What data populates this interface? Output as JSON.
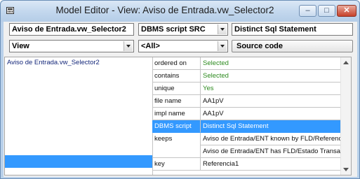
{
  "window": {
    "title": "Model Editor - View: Aviso de Entrada.vw_Selector2",
    "controls": {
      "minimize": "–",
      "maximize": "□",
      "close": "✕"
    }
  },
  "toolbar": {
    "object_name": "Aviso de Entrada.vw_Selector2",
    "script_type": "DBMS script SRC",
    "statement": "Distinct Sql Statement",
    "view_select": "View",
    "filter_select": "<All>",
    "source_code_label": "Source code"
  },
  "tree": {
    "item": "Aviso de Entrada.vw_Selector2"
  },
  "properties": [
    {
      "key": "ordered on",
      "value": "Selected",
      "color": "green"
    },
    {
      "key": "contains",
      "value": "Selected",
      "color": "green"
    },
    {
      "key": "unique",
      "value": "Yes",
      "color": "green"
    },
    {
      "key": "file name",
      "value": "AA1pV",
      "color": "normal"
    },
    {
      "key": "impl name",
      "value": "AA1pV",
      "color": "normal"
    },
    {
      "key": "DBMS script",
      "value": "Distinct Sql Statement",
      "color": "normal",
      "selected": true
    },
    {
      "key": "keeps",
      "value": "Aviso de Entrada/ENT known by FLD/Referencia",
      "color": "normal"
    },
    {
      "key": "",
      "value": "Aviso de Entrada/ENT has FLD/Estado Transacc",
      "color": "normal"
    },
    {
      "key": "key",
      "value": "Referencia1",
      "color": "normal"
    }
  ],
  "colors": {
    "selection": "#3399ff",
    "green_value": "#2c8a1e",
    "tree_text": "#14277a"
  }
}
